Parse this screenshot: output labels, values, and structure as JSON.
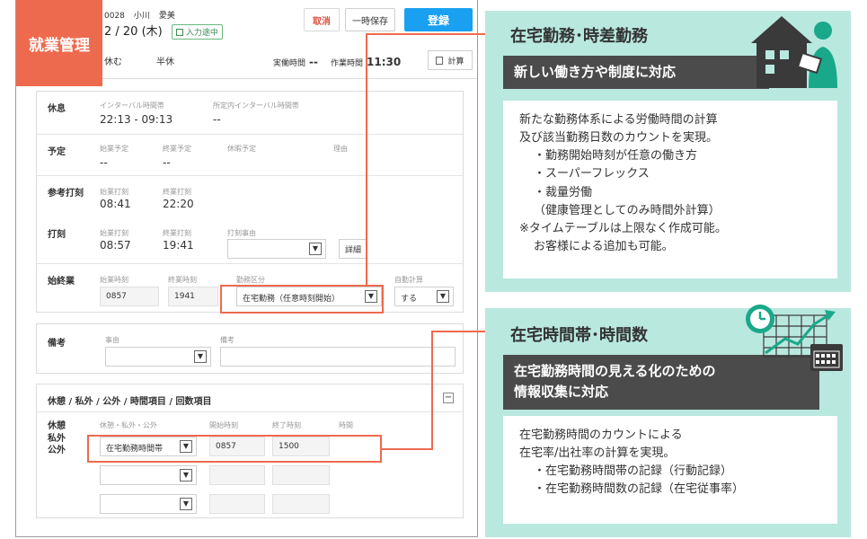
{
  "module_label": "就業管理",
  "header": {
    "employee_code": "0028",
    "employee_last": "小川",
    "employee_first": "愛美",
    "date": "2 / 20 (木)",
    "status": "入力途中",
    "cancel_label": "取消",
    "temp_save_label": "一時保存",
    "register_label": "登録",
    "day_type_1": "休む",
    "day_type_2": "半休",
    "actual_hours_label": "実働時間",
    "actual_hours_value": "--",
    "work_time_label": "作業時間",
    "work_time_value": "11:30",
    "calc_label": "計算"
  },
  "rest": {
    "label": "休息",
    "interval_caption": "インターバル時間帯",
    "interval_value": "22:13 - 09:13",
    "in_hours_caption": "所定内インターバル時間帯",
    "in_hours_value": "--"
  },
  "plan": {
    "label": "予定",
    "start_caption": "始業予定",
    "start_value": "--",
    "end_caption": "終業予定",
    "end_value": "--",
    "leave_caption": "休暇予定",
    "reason_caption": "理由"
  },
  "ref_punch": {
    "label": "参考打刻",
    "start_caption": "始業打刻",
    "start_value": "08:41",
    "end_caption": "終業打刻",
    "end_value": "22:20"
  },
  "punch": {
    "label": "打刻",
    "start_caption": "始業打刻",
    "start_value": "08:57",
    "end_caption": "終業打刻",
    "end_value": "19:41",
    "reason_caption": "打刻事由",
    "detail_label": "詳細"
  },
  "work": {
    "label": "始終業",
    "start_caption": "始業時刻",
    "start_value": "0857",
    "end_caption": "終業時刻",
    "end_value": "1941",
    "type_caption": "勤務区分",
    "type_value": "在宅勤務（任意時刻開始）",
    "auto_caption": "自動計算",
    "auto_value": "する"
  },
  "notes": {
    "label": "備考",
    "reason_caption": "事由",
    "note_caption": "備考"
  },
  "breaks": {
    "section_title": "休憩 / 私外 / 公外 / 時間項目 / 回数項目",
    "label_1": "休憩",
    "label_2": "私外",
    "label_3": "公外",
    "type_caption": "休憩・私外・公外",
    "start_caption": "開始時刻",
    "end_caption": "終了時刻",
    "hours_caption": "時間",
    "row1_type": "在宅勤務時間帯",
    "row1_start": "0857",
    "row1_end": "1500"
  },
  "panel1": {
    "title": "在宅勤務･時差勤務",
    "band": "新しい働き方や制度に対応",
    "line1": "新たな勤務体系による労働時間の計算",
    "line2": "及び該当勤務日数のカウントを実現。",
    "bullet1": "・勤務開始時刻が任意の働き方",
    "bullet2": "・スーパーフレックス",
    "bullet3": "・裁量労働",
    "bullet3_note": "（健康管理としてのみ時間外計算）",
    "note1": "※タイムテーブルは上限なく作成可能。",
    "note2": "お客様による追加も可能。"
  },
  "panel2": {
    "title": "在宅時間帯･時間数",
    "band_line1": "在宅勤務時間の見える化のための",
    "band_line2": "情報収集に対応",
    "line1": "在宅勤務時間のカウントによる",
    "line2": "在宅率/出社率の計算を実現。",
    "bullet1": "・在宅勤務時間帯の記録（行動記録）",
    "bullet2": "・在宅勤務時間数の記録（在宅従事率）"
  },
  "colors": {
    "accent": "#ee6a4f",
    "panel_bg": "#b9e8df",
    "teal": "#1aa88a",
    "dark_band": "#4b4b4b",
    "primary_button": "#1aa0f0"
  }
}
